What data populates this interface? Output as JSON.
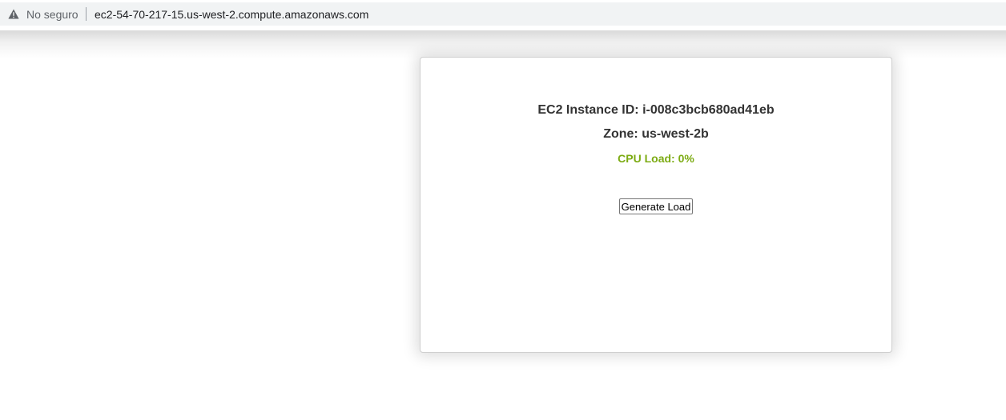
{
  "browser": {
    "security_label": "No seguro",
    "url": "ec2-54-70-217-15.us-west-2.compute.amazonaws.com",
    "security_icon": "warning-triangle-icon"
  },
  "card": {
    "instance_label": "EC2 Instance ID:",
    "instance_id": "i-008c3bcb680ad41eb",
    "zone_label": "Zone:",
    "zone": "us-west-2b",
    "cpu_label": "CPU Load:",
    "cpu_load": "0%",
    "cpu_color": "#7cab13",
    "button_label": "Generate Load"
  }
}
